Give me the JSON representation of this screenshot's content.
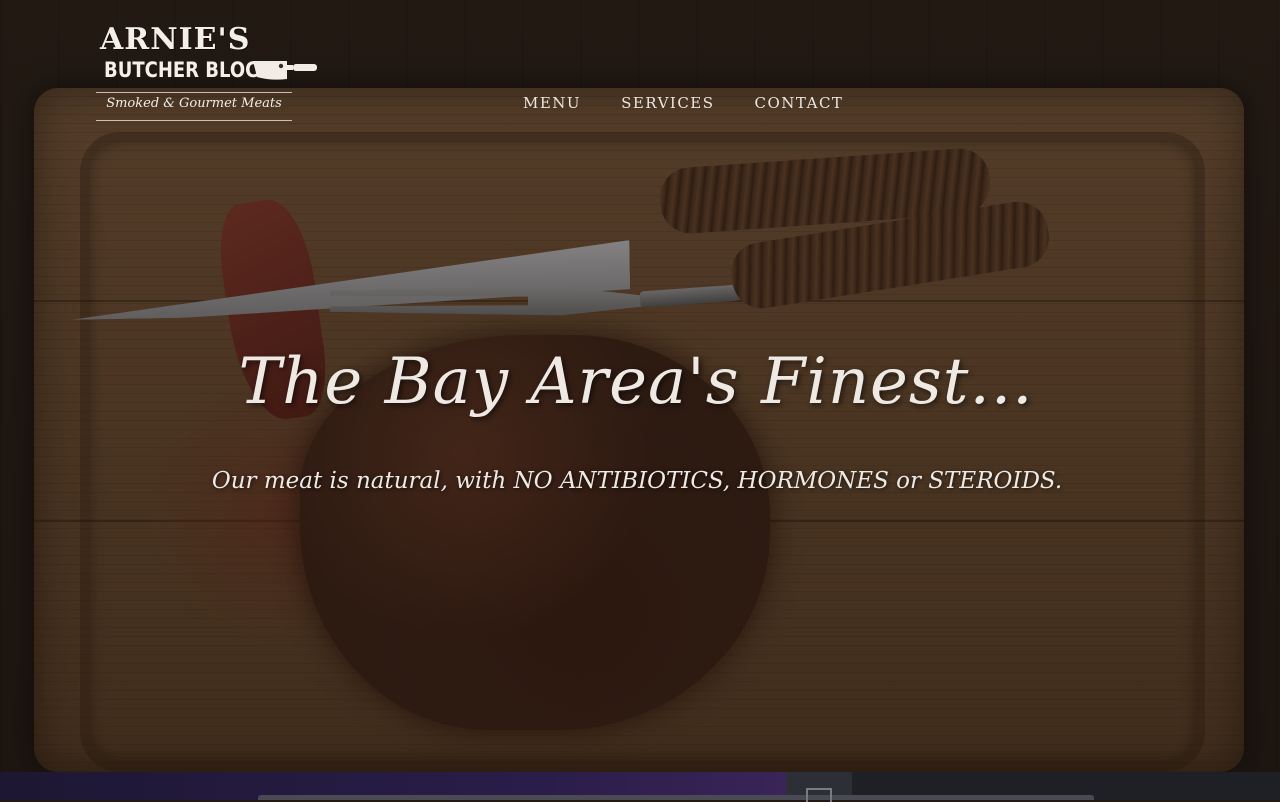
{
  "logo": {
    "line1": "ARNIE'S",
    "line2": "BUTCHER BLOCK",
    "tagline": "Smoked & Gourmet Meats",
    "icon": "cleaver-icon"
  },
  "nav": {
    "items": [
      {
        "label": "MENU"
      },
      {
        "label": "SERVICES"
      },
      {
        "label": "CONTACT"
      }
    ]
  },
  "hero": {
    "title": "The Bay Area's Finest...",
    "subtitle": "Our meat is natural, with NO ANTIBIOTICS, HORMONES or STEROIDS."
  },
  "colors": {
    "text": "#efe9e4",
    "wood": "#6d4f34",
    "background": "#231a14"
  }
}
